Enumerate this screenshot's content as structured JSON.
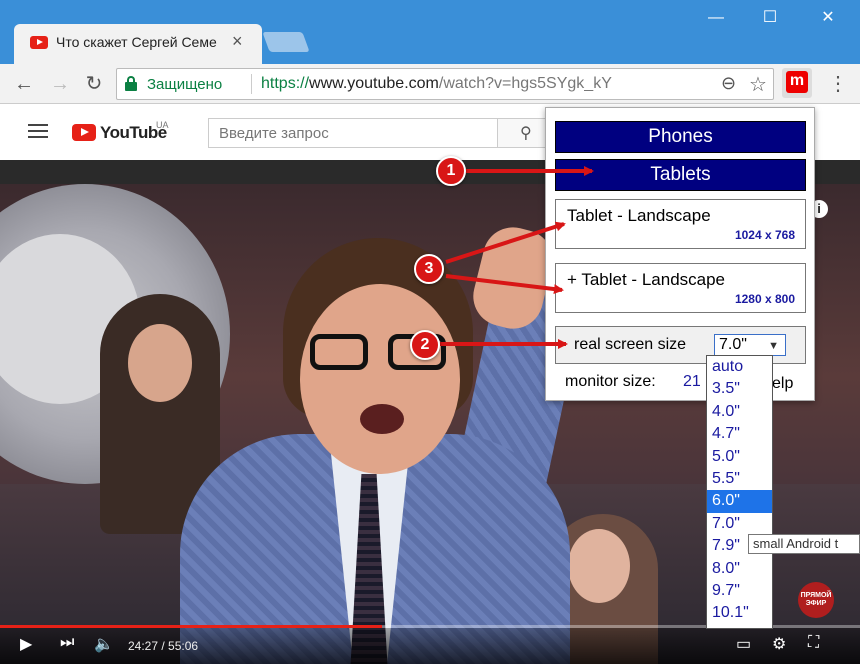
{
  "browser": {
    "tab_title": "Что скажет Сергей Семе",
    "tab_close": "×",
    "window_minimize": "—",
    "window_maximize": "☐",
    "window_close": "✕",
    "secure_label": "Защищено",
    "url_scheme": "https://",
    "url_host": "www.youtube.com",
    "url_path": "/watch?v=hgs5SYgk_kY",
    "extension_letter": "m"
  },
  "youtube": {
    "logo_text": "YouTube",
    "logo_region": "UA",
    "search_placeholder": "Введите запрос",
    "time_current": "24:27",
    "time_separator": " / ",
    "time_total": "55:06",
    "progress": 0.444,
    "live_badge": "ПРЯМОЙ ЭФИР"
  },
  "popup": {
    "category_phones": "Phones",
    "category_tablets": "Tablets",
    "option1_label_pre": "Tablet - ",
    "option1_label_bold": "Landscape",
    "option1_res": "1024 x 768",
    "option2_label_pre": "+ Tablet - ",
    "option2_label_bold": "Landscape",
    "option2_res": "1280 x 800",
    "real_size_label": "real screen size",
    "real_size_value": "7.0\"",
    "monitor_label": "monitor size:",
    "monitor_value": "21",
    "help_text": "elp"
  },
  "dropdown": {
    "options": [
      "auto",
      "3.5\"",
      "4.0\"",
      "4.7\"",
      "5.0\"",
      "5.5\"",
      "6.0\"",
      "7.0\"",
      "7.9\"",
      "8.0\"",
      "9.7\"",
      "10.1\""
    ],
    "highlighted": "6.0\""
  },
  "tooltip": "small Android t",
  "annotations": {
    "badge1": "1",
    "badge2": "2",
    "badge3": "3"
  },
  "colors": {
    "popup_category_bg": "#000080",
    "annotation_red": "#d81616",
    "youtube_red": "#e62117",
    "secure_green": "#0b8043",
    "dropdown_highlight": "#1e73e8"
  }
}
